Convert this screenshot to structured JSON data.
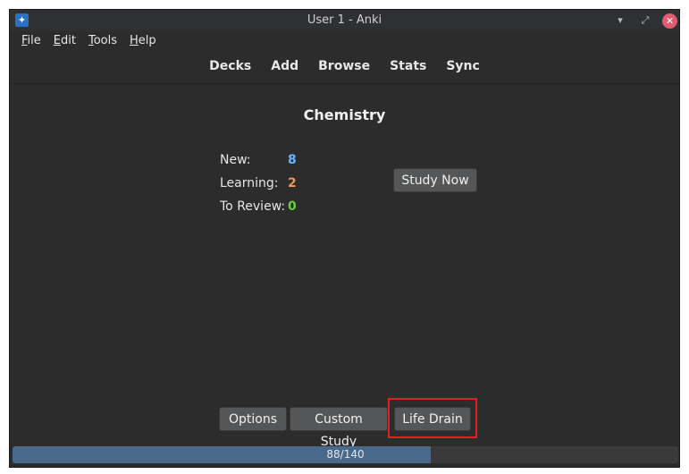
{
  "window": {
    "title": "User 1 - Anki",
    "app_icon": "anki-star-icon"
  },
  "menubar": [
    {
      "underline": "F",
      "rest": "ile"
    },
    {
      "underline": "E",
      "rest": "dit"
    },
    {
      "underline": "T",
      "rest": "ools"
    },
    {
      "underline": "H",
      "rest": "elp"
    }
  ],
  "toolbar": {
    "decks": "Decks",
    "add": "Add",
    "browse": "Browse",
    "stats": "Stats",
    "sync": "Sync"
  },
  "deck": {
    "title": "Chemistry",
    "new_label": "New:",
    "new_value": "8",
    "learning_label": "Learning:",
    "learning_value": "2",
    "review_label": "To Review:",
    "review_value": "0",
    "study_button": "Study Now"
  },
  "colors": {
    "new": "#6bb3ff",
    "learning": "#f0965a",
    "review": "#6ccc3a",
    "highlight": "#e02020"
  },
  "bottom_buttons": {
    "options": "Options",
    "custom_study": "Custom Study",
    "life_drain": "Life Drain"
  },
  "progress": {
    "text": "88/140",
    "fraction": 0.6286
  }
}
